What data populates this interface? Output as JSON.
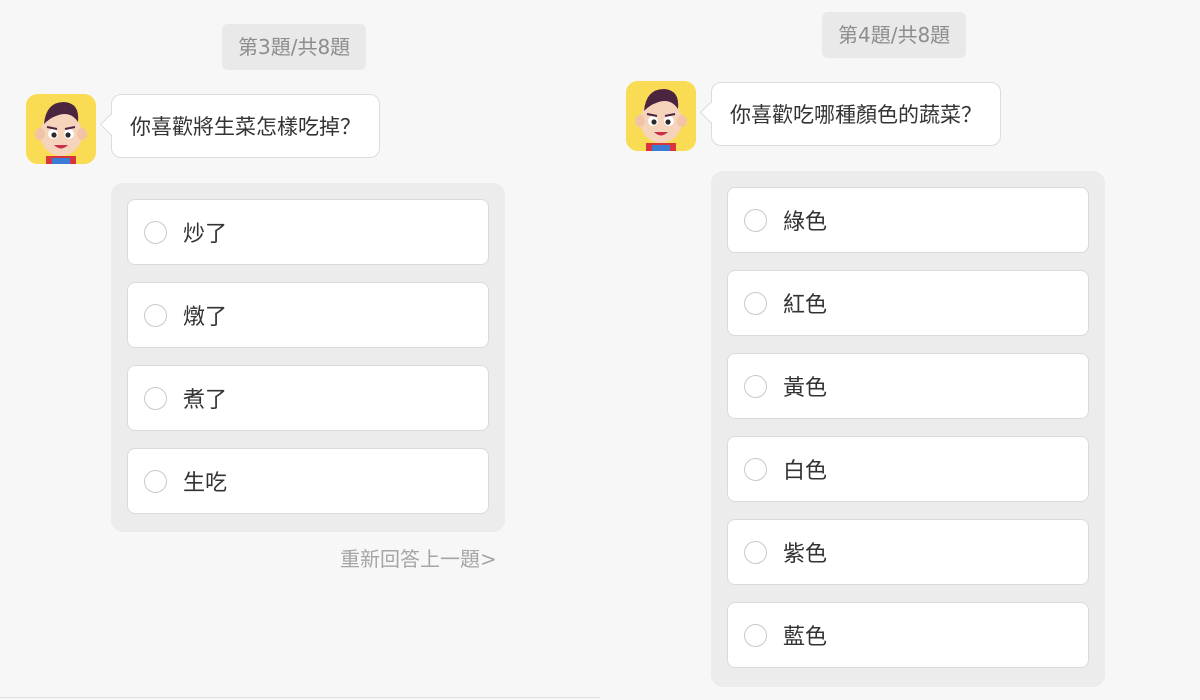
{
  "left_panel": {
    "counter": "第3題/共8題",
    "question": "你喜歡將生菜怎樣吃掉？",
    "options": [
      "炒了",
      "燉了",
      "煮了",
      "生吃"
    ],
    "redo_link": "重新回答上一題>"
  },
  "right_panel": {
    "counter": "第4題/共8題",
    "question": "你喜歡吃哪種顏色的蔬菜？",
    "options": [
      "綠色",
      "紅色",
      "黃色",
      "白色",
      "紫色",
      "藍色"
    ]
  },
  "colors": {
    "background": "#f7f7f7",
    "option_group_bg": "#ececec",
    "avatar_bg": "#f9dc53",
    "muted_text": "#8d8d8d"
  },
  "icons": {
    "avatar": "cartoon-boy-avatar",
    "radio": "radio-circle-icon"
  }
}
